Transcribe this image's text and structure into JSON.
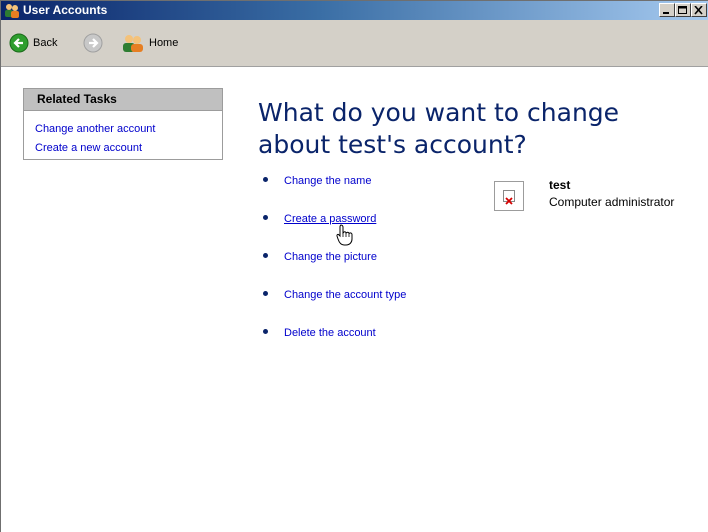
{
  "window": {
    "title": "User Accounts",
    "controls": [
      "minimize-icon",
      "maximize-icon",
      "close-icon"
    ]
  },
  "toolbar": {
    "back_label": "Back",
    "forward_icon": "forward-arrow-icon",
    "home_label": "Home"
  },
  "sidebar": {
    "heading": "Related Tasks",
    "links": [
      "Change another account",
      "Create a new account"
    ]
  },
  "main": {
    "heading": "What do you want to change about test's account?",
    "tasks": [
      "Change the name",
      "Create a password",
      "Change the picture",
      "Change the account type",
      "Delete the account"
    ]
  },
  "account": {
    "name": "test",
    "type": "Computer administrator"
  },
  "colors": {
    "heading": "#0a246a",
    "link": "#0000cc",
    "titlebar_start": "#0a246a",
    "toolbar_bg": "#d4d0c8"
  }
}
